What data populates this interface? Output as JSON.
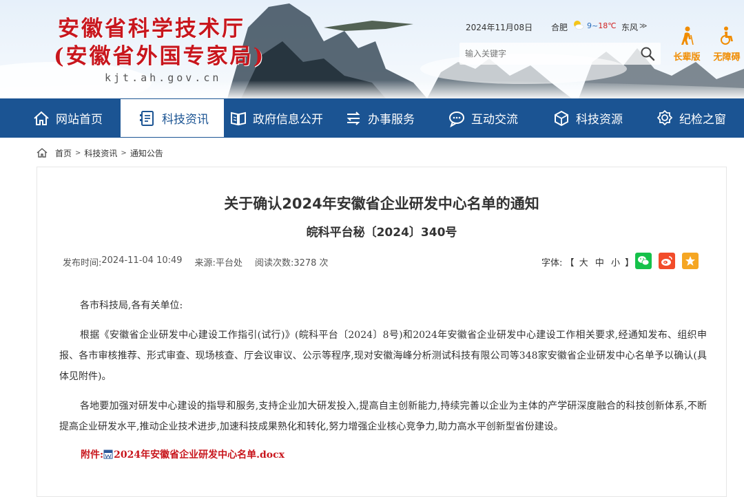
{
  "header": {
    "title_line1": "安徽省科学技术厅",
    "title_line2": "(安徽省外国专家局)",
    "domain": "kjt.ah.gov.cn",
    "date": "2024年11月08日",
    "city": "合肥",
    "temp_low": "9~",
    "temp_high": "18℃",
    "wind": "东风",
    "wind_arrow": "≫",
    "search_placeholder": "输入关键字",
    "elder_label": "长辈版",
    "barrier_label": "无障碍"
  },
  "nav": {
    "items": [
      {
        "label": "网站首页",
        "icon": "home-icon"
      },
      {
        "label": "科技资讯",
        "icon": "news-icon"
      },
      {
        "label": "政府信息公开",
        "icon": "book-icon"
      },
      {
        "label": "办事服务",
        "icon": "service-icon"
      },
      {
        "label": "互动交流",
        "icon": "chat-icon"
      },
      {
        "label": "科技资源",
        "icon": "cube-icon"
      },
      {
        "label": "纪检之窗",
        "icon": "badge-icon"
      }
    ],
    "active_index": 1
  },
  "breadcrumb": [
    "首页",
    "科技资讯",
    "通知公告"
  ],
  "article": {
    "title": "关于确认2024年安徽省企业研发中心名单的通知",
    "doc_no": "皖科平台秘〔2024〕340号",
    "publish_label": "发布时间:",
    "publish_time": "2024-11-04 10:49",
    "source_label": "来源:",
    "source": "平台处",
    "views_label": "阅读次数:",
    "views": "3278 次",
    "font_label": "字体:",
    "font_open": "【",
    "font_large": "大",
    "font_medium": "中",
    "font_small": "小",
    "font_close": "】",
    "greeting": "各市科技局,各有关单位:",
    "para1": "根据《安徽省企业研发中心建设工作指引(试行)》(皖科平台〔2024〕8号)和2024年安徽省企业研发中心建设工作相关要求,经通知发布、组织申报、各市审核推荐、形式审查、现场核查、厅会议审议、公示等程序,现对安徽海峰分析测试科技有限公司等348家安徽省企业研发中心名单予以确认(具体见附件)。",
    "para2": "各地要加强对研发中心建设的指导和服务,支持企业加大研发投入,提高自主创新能力,持续完善以企业为主体的产学研深度融合的科技创新体系,不断提高企业研发水平,推动企业技术进步,加速科技成果熟化和转化,努力增强企业核心竞争力,助力高水平创新型省份建设。",
    "attachment_label": "附件:",
    "attachment_file": "2024年安徽省企业研发中心名单.docx"
  },
  "colors": {
    "nav_bg": "#1b5493",
    "title_red": "#c8161d",
    "accent_orange": "#f08c00"
  }
}
